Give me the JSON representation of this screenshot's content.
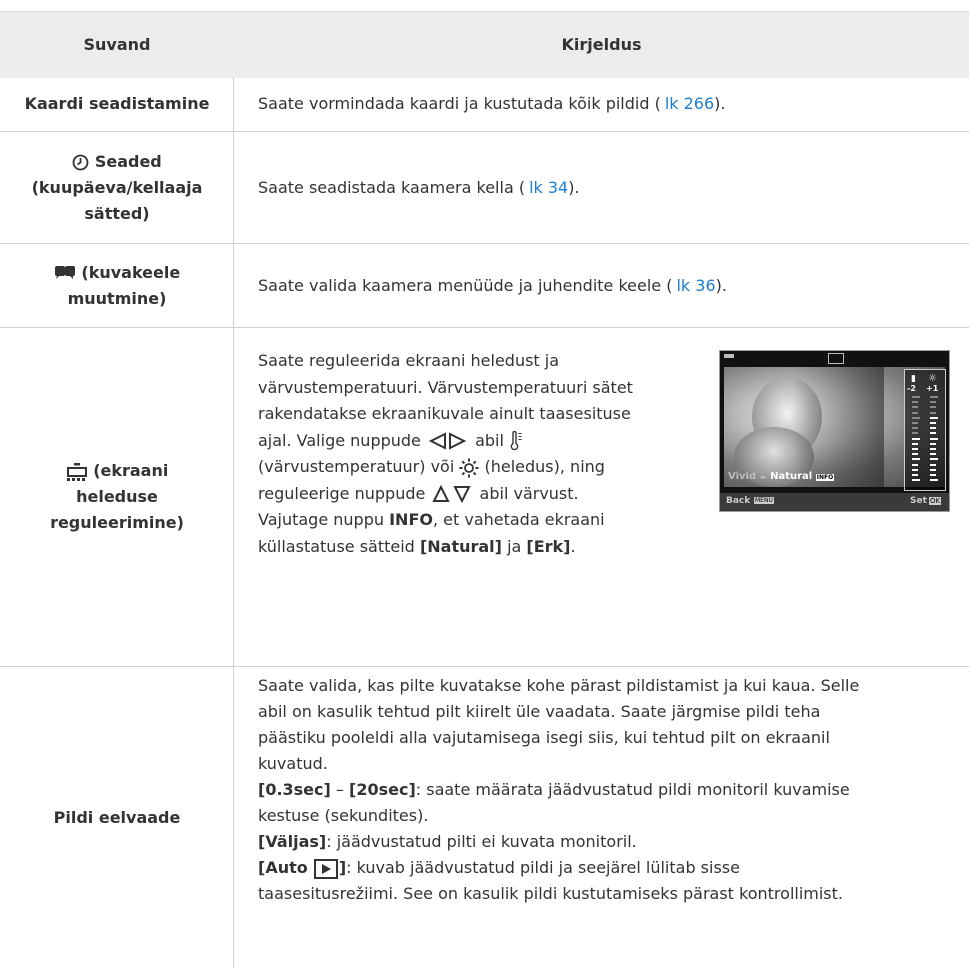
{
  "header": {
    "col_option": "Suvand",
    "col_description": "Kirjeldus"
  },
  "rows": [
    {
      "option": "Kaardi seadistamine",
      "description": "Saate vormindada kaardi ja kustutada kõik pildid (",
      "link": "lk 266",
      "after": ")."
    },
    {
      "option_line1": "Seaded",
      "option_line2": "(kuupäeva/kellaaja",
      "option_line3": "sätted)",
      "option_icon": "clock-icon",
      "description": "Saate seadistada kaamera kella (",
      "link": "lk 34",
      "after": ")."
    },
    {
      "option_line1": "(kuvakeele",
      "option_line2": "muutmine)",
      "option_icon": "language-icon",
      "description": "Saate valida kaamera menüüde ja juhendite keele (",
      "link": "lk 36",
      "after": ")."
    },
    {
      "option_line1": "(ekraani",
      "option_line2": "heleduse",
      "option_line3": "reguleerimine)",
      "option_icon": "monitor-brightness-icon",
      "desc_lines": [
        "Saate reguleerida ekraani heledust ja",
        "värvustemperatuuri. Värvustemperatuuri sätet",
        "rakendatakse ekraanikuvale ainult taasesituse",
        "ajal. Valige nuppude",
        "abil",
        "(värvustemperatuur) või",
        "(heledus), ning",
        "reguleerige nuppude",
        "abil värvust.",
        "Vajutage nuppu",
        "INFO",
        ", et vahetada ekraani",
        "küllastatuse sätteid",
        "[Natural]",
        "ja",
        "[Erk]",
        "."
      ],
      "screen": {
        "vivid": "Vivid",
        "natural": "Natural",
        "info": "INFO",
        "back": "Back",
        "menu": "MENU",
        "set": "Set",
        "ok": "OK",
        "minus2": "-2",
        "plus1": "+1",
        "slider_temp_level": 0.5,
        "slider_bright_level": 0.75
      }
    },
    {
      "option": "Pildi eelvaade",
      "p1_lines": [
        "Saate valida, kas pilte kuvatakse kohe pärast pildistamist ja kui kaua. Selle",
        "abil on kasulik tehtud pilt kiirelt üle vaadata. Saate järgmise pildi teha",
        "päästiku pooleldi alla vajutamisega isegi siis, kui tehtud pilt on ekraanil",
        "kuvatud."
      ],
      "p2_b1": "[0.3sec]",
      "p2_dash": " – ",
      "p2_b2": "[20sec]",
      "p2_rest": ": saate määrata jäädvustatud pildi monitoril kuvamise",
      "p2_line2": "kestuse (sekundites).",
      "p3_b": "[Väljas]",
      "p3_rest": ": jäädvustatud pilti ei kuvata monitoril.",
      "p4_b": "[Auto",
      "p4_b_end": "]",
      "p4_rest": ": kuvab jäädvustatud pildi ja seejärel lülitab sisse",
      "p4_line2": "taasesitusrežiimi. See on kasulik pildi kustutamiseks pärast kontrollimist."
    }
  ],
  "colors": {
    "link": "#1e7fd0",
    "header_bg": "#ececec",
    "border": "#cfcfcf",
    "text": "#333333"
  }
}
